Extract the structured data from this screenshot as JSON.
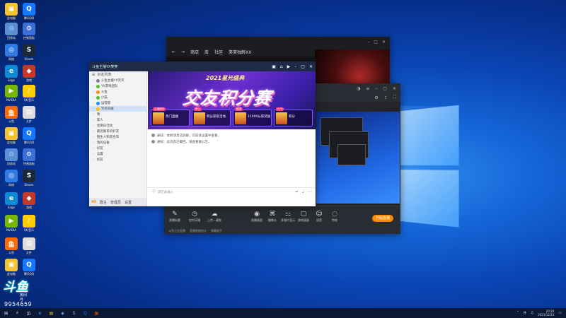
{
  "desktop": {
    "icons": [
      {
        "label": "此电脑",
        "color": "#f4c430",
        "glyph": "▣"
      },
      {
        "label": "腾讯QQ",
        "color": "#1677ff",
        "glyph": "Q"
      },
      {
        "label": "回收站",
        "color": "#5a8fd6",
        "glyph": "♲"
      },
      {
        "label": "控制面板",
        "color": "#3b6fd8",
        "glyph": "⚙"
      },
      {
        "label": "网络",
        "color": "#2f7be0",
        "glyph": "◎"
      },
      {
        "label": "Steam",
        "color": "#1b2838",
        "glyph": "S"
      },
      {
        "label": "Edge",
        "color": "#0f8bd6",
        "glyph": "e"
      },
      {
        "label": "游戏",
        "color": "#c0392b",
        "glyph": "◆"
      },
      {
        "label": "NVIDIA",
        "color": "#76b900",
        "glyph": "▶"
      },
      {
        "label": "QQ音乐",
        "color": "#ffce00",
        "glyph": "♪"
      },
      {
        "label": "斗鱼",
        "color": "#ff6a00",
        "glyph": "鱼"
      },
      {
        "label": "文件",
        "color": "#dddddd",
        "glyph": "▤"
      }
    ]
  },
  "game_window": {
    "nav": [
      "←",
      "→",
      "商店",
      "库",
      "社区",
      "笑笑独醉XX"
    ]
  },
  "stream_window": {
    "tools": [
      {
        "icon": "◉",
        "label": "直播画面"
      },
      {
        "icon": "⌘",
        "label": "摄像头"
      },
      {
        "icon": "⚏",
        "label": "多镜片显示"
      },
      {
        "icon": "▢",
        "label": "游戏画面"
      },
      {
        "icon": "☺",
        "label": "语音"
      },
      {
        "icon": "◌",
        "label": "特效"
      }
    ],
    "left_tools": [
      {
        "icon": "✎",
        "label": "直播标题"
      },
      {
        "icon": "◷",
        "label": "定时开播"
      },
      {
        "icon": "☁",
        "label": "上传一键发"
      }
    ],
    "start_label": "开始直播",
    "status_items": [
      "斗鱼正在直播",
      "直播数据统计",
      "弹幕助手"
    ]
  },
  "qq_window": {
    "title": "斗鱼主播YX笑笑",
    "tab": "好友列表",
    "groups": [
      {
        "name": "斗鱼主播YX笑笑",
        "color": "#7a7f8a",
        "selected": false
      },
      {
        "name": "YX游戏团队",
        "color": "#52c41a",
        "selected": false
      },
      {
        "name": "斗鱼",
        "color": "#fa8c16",
        "selected": false
      },
      {
        "name": "小猫",
        "color": "#52c41a",
        "selected": false
      },
      {
        "name": "运营部",
        "color": "#1890ff",
        "selected": false
      },
      {
        "name": "笑笑的群",
        "color": "#f5c400",
        "selected": true
      }
    ],
    "friends": [
      "我",
      "家人",
      "星期日活动",
      "最近联系的好友",
      "陌生人和黑名单",
      "我的设备",
      "好友",
      "设置",
      "好友"
    ],
    "banner": {
      "small": "2021星光盛典",
      "big": "交友积分赛",
      "tiles": [
        {
          "tag": "主播福利",
          "text": "热门直播"
        },
        {
          "tag": "新人",
          "text": "积分获取活动"
        },
        {
          "tag": "组团",
          "text": "11000分获奖励"
        },
        {
          "tag": "人气",
          "text": "积分"
        }
      ]
    },
    "messages": [
      "通知：本群消息已屏蔽，可前往设置中查看。",
      "通知：此消息已撤回，请查看群公告。"
    ],
    "input_placeholder": "请在此输入",
    "bottom": [
      "40",
      "群主",
      "管理员",
      "设置"
    ]
  },
  "watermark": {
    "logo": "斗鱼",
    "sub": "房间号",
    "room": "9954659"
  },
  "taskbar": {
    "icons": [
      "⊞",
      "⌕",
      "◫",
      "e",
      "▤",
      "◈",
      "S",
      "Q",
      "鱼"
    ],
    "time": "20:20",
    "date": "2021/12/23"
  }
}
